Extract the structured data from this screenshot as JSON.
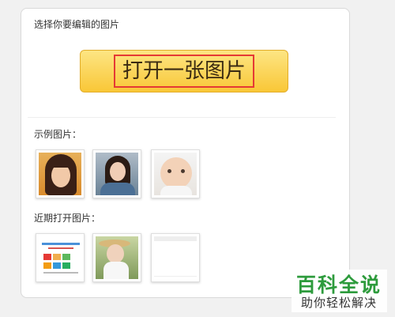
{
  "header": {
    "title": "选择你要编辑的图片"
  },
  "open_button": {
    "label": "打开一张图片"
  },
  "examples": {
    "title": "示例图片：",
    "items": [
      {
        "name": "example-photo-1"
      },
      {
        "name": "example-photo-2"
      },
      {
        "name": "example-photo-3"
      }
    ]
  },
  "recent": {
    "title": "近期打开图片：",
    "items": [
      {
        "name": "recent-photo-1"
      },
      {
        "name": "recent-photo-2"
      },
      {
        "name": "recent-photo-3"
      }
    ]
  },
  "watermark": {
    "logo": "百科全说",
    "tagline": "助你轻松解决"
  },
  "colors": {
    "button_top": "#fde583",
    "button_bottom": "#f9c737",
    "highlight_border": "#e53935",
    "watermark_green": "#2d9b3c"
  }
}
